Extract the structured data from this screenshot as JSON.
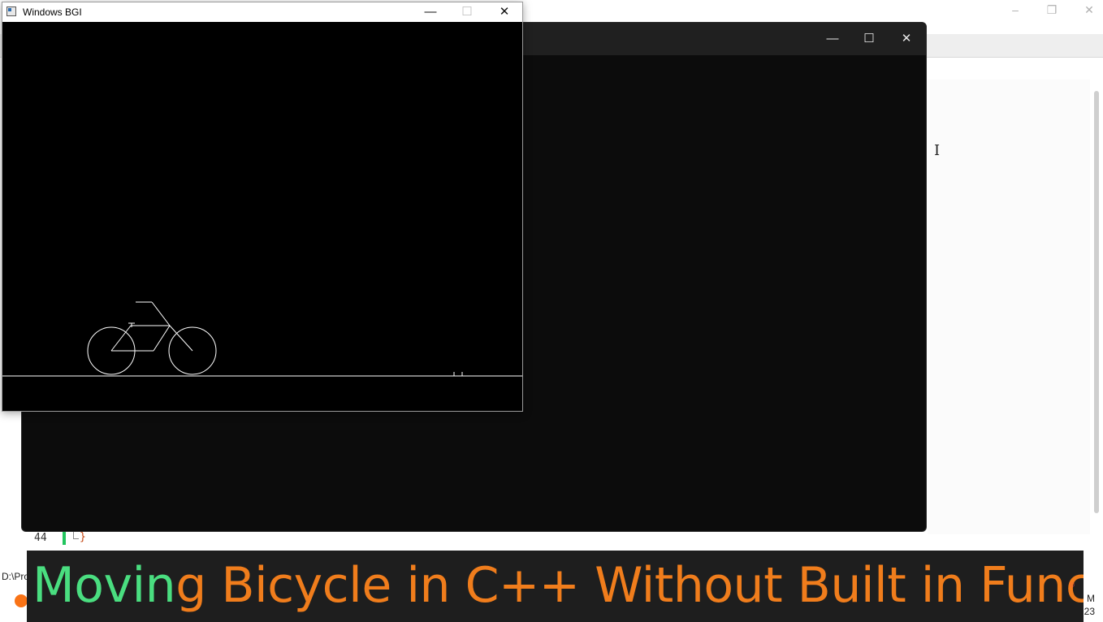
{
  "ide": {
    "window_controls": {
      "minimize": "–",
      "restore": "❐",
      "close": "✕"
    },
    "editor": {
      "line_number": "44",
      "code_text": "}"
    },
    "status_bar": {
      "path_fragment": "D:\\Pro"
    },
    "tray": {
      "time_fragment": "M",
      "date_fragment": "23"
    }
  },
  "console_window": {
    "controls": {
      "minimize": "—",
      "maximize": "☐",
      "close": "✕"
    }
  },
  "bgi_window": {
    "title": "Windows BGI",
    "controls": {
      "minimize": "—",
      "maximize": "☐",
      "close": "✕"
    }
  },
  "caption": {
    "part1": "Movin",
    "part2": "g Bicycle in C++ Without Built in Function",
    "colors": {
      "green": "#4ade80",
      "orange": "#f07d1c",
      "background": "#1e1e1e"
    }
  },
  "icons": [
    "app-window-icon",
    "ibeam-cursor-icon",
    "taskbar-app-icon",
    "channel-watermark-icon"
  ]
}
